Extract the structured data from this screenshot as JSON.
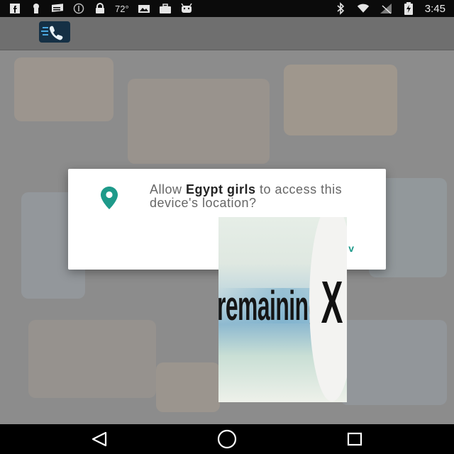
{
  "status_bar": {
    "temperature": "72°",
    "time": "3:45",
    "left_icons": [
      "facebook-icon",
      "keyhole-icon",
      "news-icon",
      "info-circle-icon",
      "lock-icon",
      "temperature-text",
      "image-mail-icon",
      "briefcase-icon",
      "android-icon"
    ],
    "right_icons": [
      "bluetooth-icon",
      "wifi-icon",
      "no-signal-icon",
      "battery-charging-icon"
    ]
  },
  "app_bar": {
    "logo_icon": "phone-call-logo-icon"
  },
  "dialog": {
    "text_prefix": "Allow ",
    "app_name": "Egypt girls",
    "text_suffix": " to access this device's location?",
    "visible_button_fragment": "v",
    "icon": "location-pin-icon",
    "accent_color": "#1e9a8a"
  },
  "ad_overlay": {
    "text": "remaining",
    "close_label": "X"
  },
  "navbar": {
    "back_icon": "back-triangle-icon",
    "home_icon": "home-circle-icon",
    "recents_icon": "recents-square-icon"
  }
}
